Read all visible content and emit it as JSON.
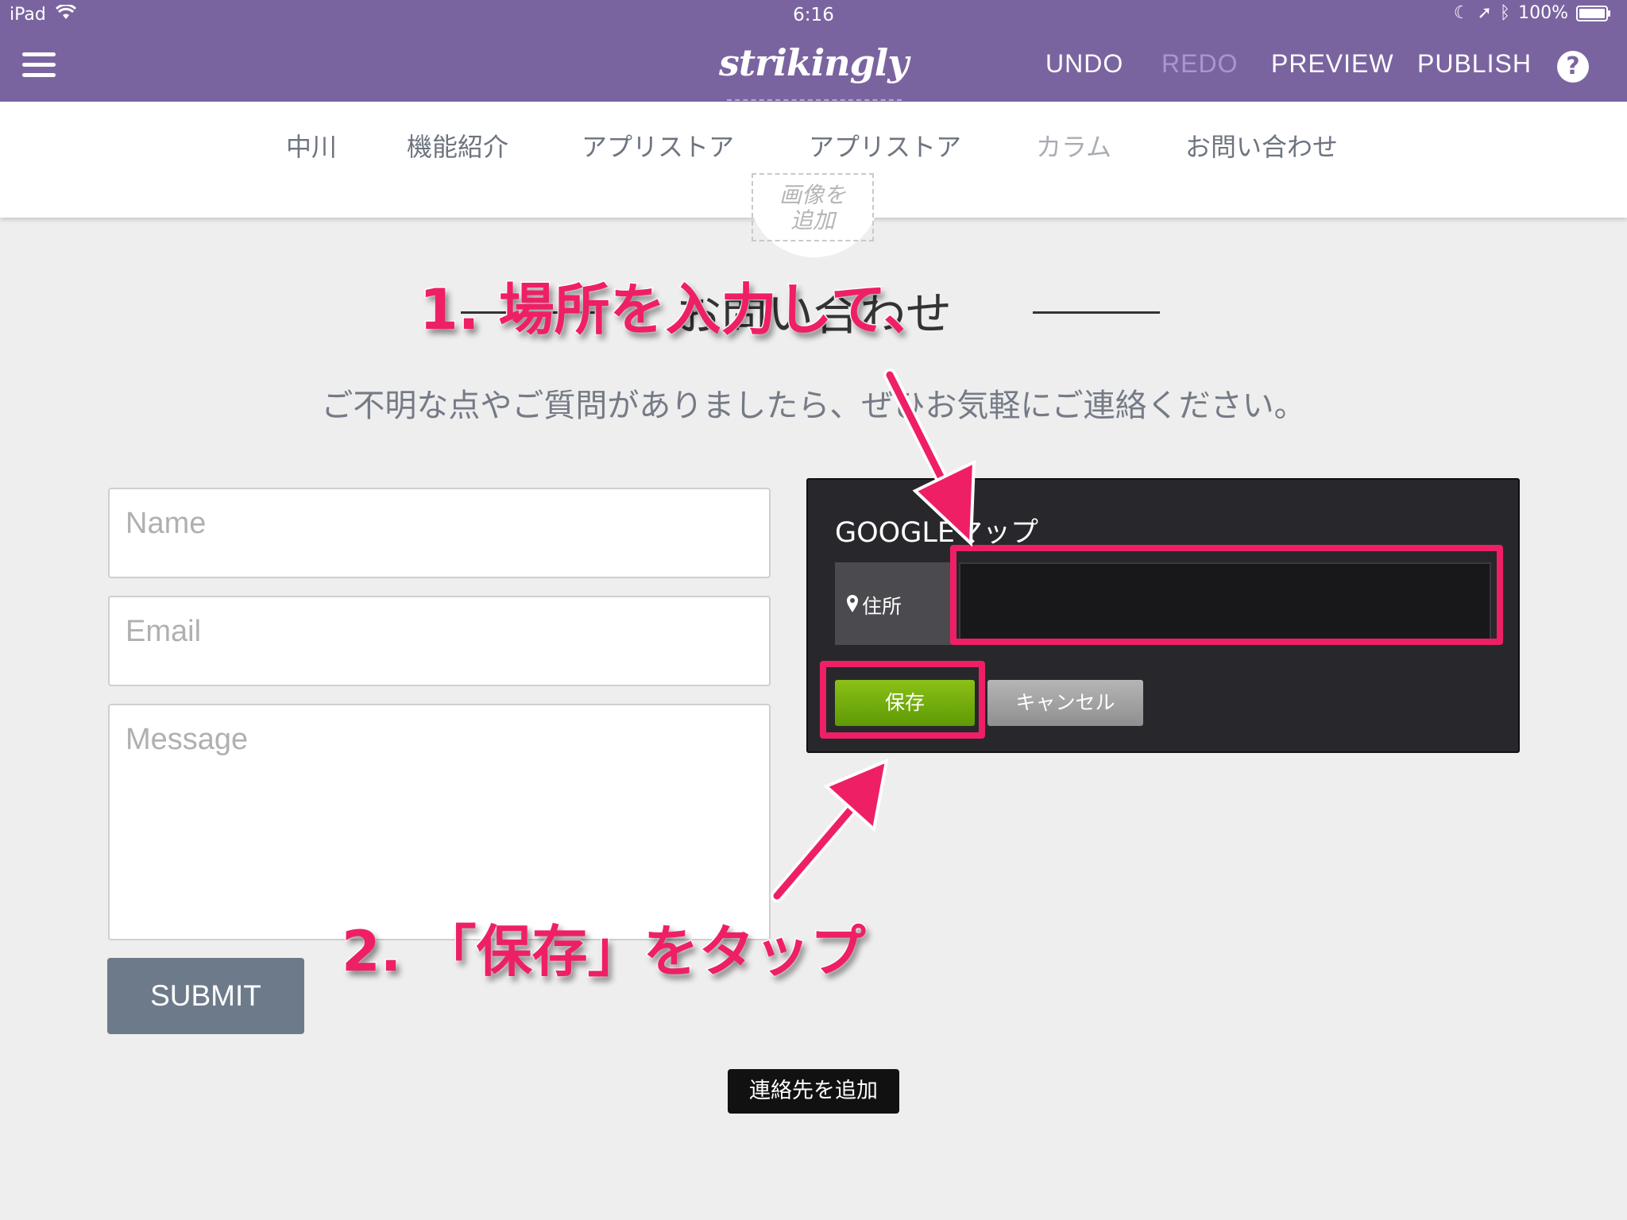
{
  "status_bar": {
    "device": "iPad",
    "time": "6:16",
    "battery": "100%"
  },
  "app_bar": {
    "brand": "strikingly",
    "actions": {
      "undo": "UNDO",
      "redo": "REDO",
      "preview": "PREVIEW",
      "publish": "PUBLISH"
    },
    "help": "?"
  },
  "site_nav": {
    "items": [
      "中川",
      "機能紹介",
      "アプリストア",
      "アプリストア",
      "カラム",
      "お問い合わせ"
    ]
  },
  "add_image": {
    "line1": "画像を",
    "line2": "追加"
  },
  "section": {
    "title": "お問い合わせ",
    "subtitle": "ご不明な点やご質問がありましたら、ぜひお気軽にご連絡ください。"
  },
  "form": {
    "name_placeholder": "Name",
    "email_placeholder": "Email",
    "message_placeholder": "Message",
    "submit": "SUBMIT"
  },
  "map_panel": {
    "title": "GOOGLEマップ",
    "address_label": "住所",
    "address_value": "",
    "save": "保存",
    "cancel": "キャンセル"
  },
  "add_contact": "連絡先を追加",
  "annotations": {
    "step1": "1. 場所を入力して、",
    "step2": "2. 「保存」をタップ",
    "color": "#ef1f66"
  },
  "colors": {
    "app_bar": "#7a64a0",
    "page_bg": "#eeeeee",
    "save_green": "#6fa80b"
  }
}
